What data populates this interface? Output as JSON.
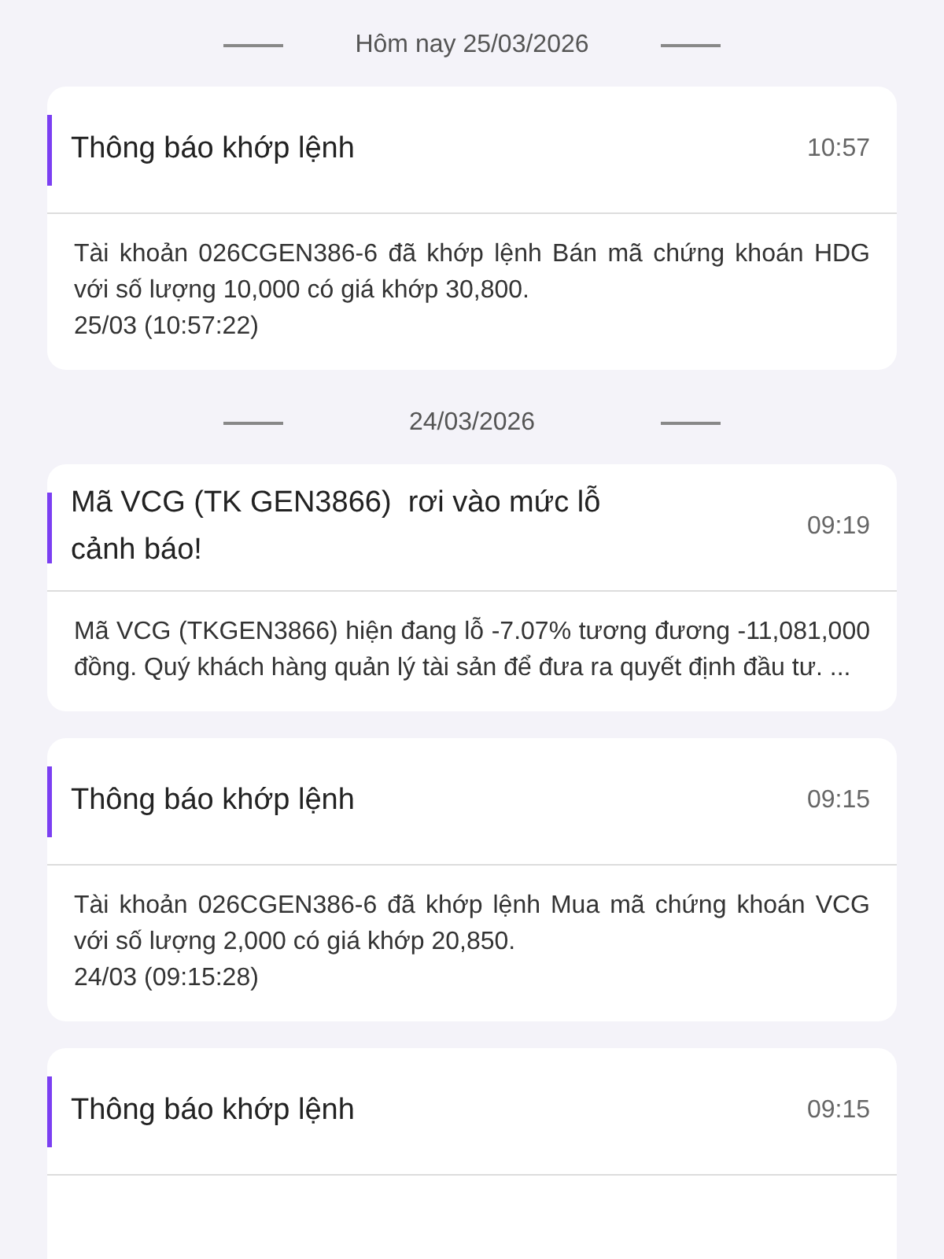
{
  "groups": [
    {
      "date": "Hôm nay 25/03/2026",
      "notifications": [
        {
          "title": "Thông báo khớp lệnh",
          "time": "10:57",
          "message": "Tài khoản 026CGEN386-6 đã khớp lệnh Bán mã chứng khoán HDG với số lượng 10,000 có giá khớp 30,800.",
          "timestamp": "25/03 (10:57:22)"
        }
      ]
    },
    {
      "date": "24/03/2026",
      "notifications": [
        {
          "title": "Mã VCG (TK GEN3866)  rơi vào mức lỗ cảnh báo!",
          "time": "09:19",
          "message": "Mã VCG (TKGEN3866) hiện đang lỗ -7.07% tương đương -11,081,000 đồng. Quý khách hàng quản lý tài sản để đưa ra quyết định đầu tư. ..."
        },
        {
          "title": "Thông báo khớp lệnh",
          "time": "09:15",
          "message": "Tài khoản 026CGEN386-6 đã khớp lệnh Mua mã chứng khoán VCG với số lượng 2,000 có giá khớp 20,850.",
          "timestamp": "24/03 (09:15:28)"
        },
        {
          "title": "Thông báo khớp lệnh",
          "time": "09:15"
        }
      ]
    }
  ]
}
